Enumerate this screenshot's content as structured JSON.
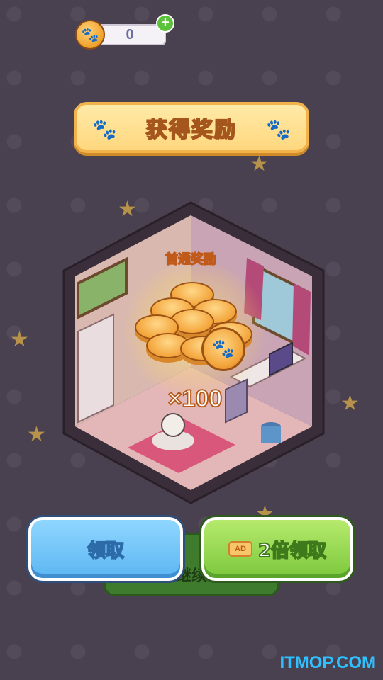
{
  "currency": {
    "value": "0",
    "coin_icon": "paw-coin-icon",
    "add_icon": "plus-icon"
  },
  "banner": {
    "title": "获得奖励"
  },
  "reward": {
    "label": "首通奖励",
    "multiplier": "×100"
  },
  "buttons": {
    "claim": "领取",
    "double_claim": "2倍领取",
    "ad_badge": "AD",
    "hidden_partial": "继续"
  },
  "watermark": "ITMOP.COM",
  "colors": {
    "background": "#4a4150",
    "banner": "#ffd77e",
    "claim_button": "#5cb6f2",
    "double_button": "#7cc83c"
  }
}
